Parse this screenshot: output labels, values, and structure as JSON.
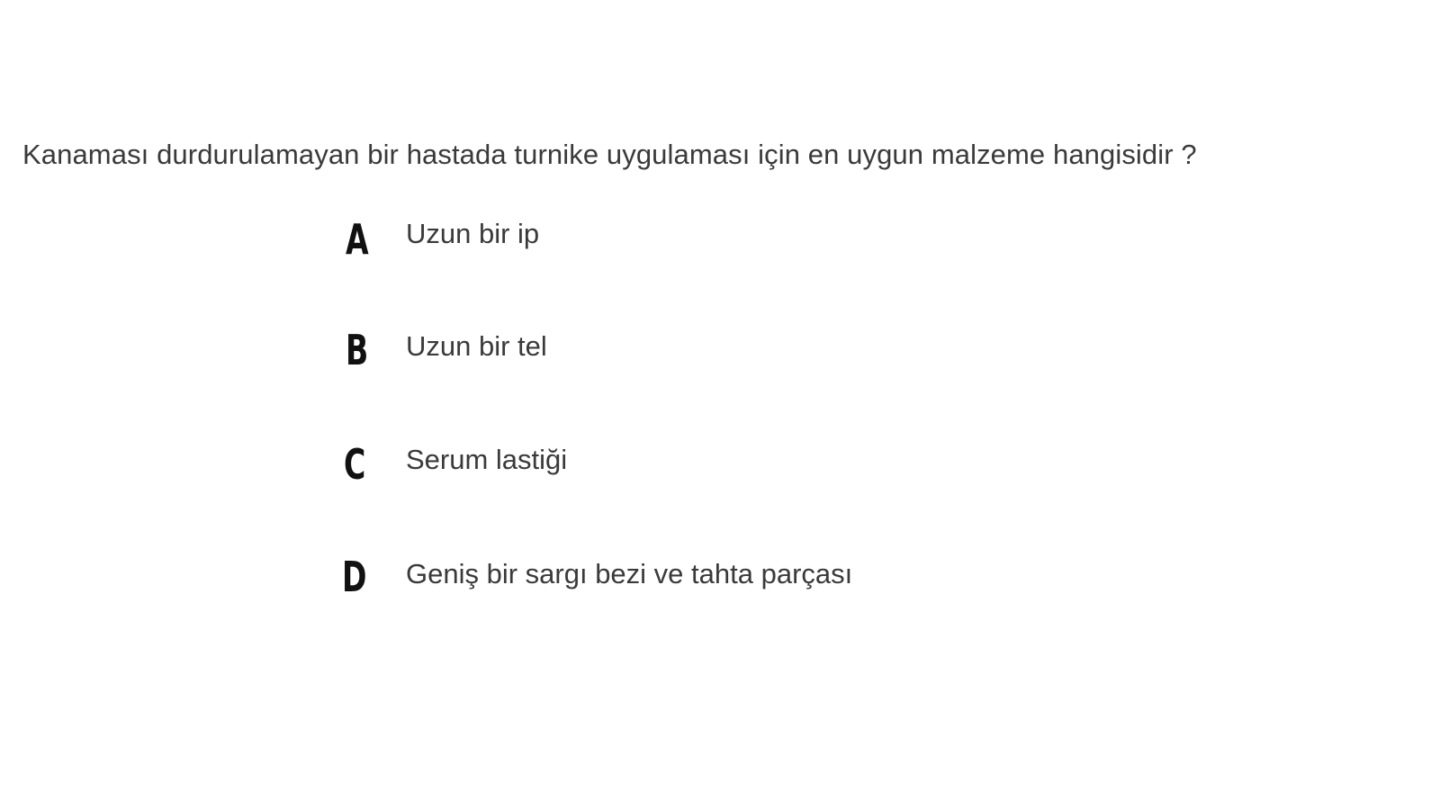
{
  "question": {
    "text": "Kanaması durdurulamayan bir hastada turnike uygulaması için en uygun malzeme hangisidir ?"
  },
  "options": [
    {
      "letter": "A",
      "text": "Uzun bir ip"
    },
    {
      "letter": "B",
      "text": "Uzun bir tel"
    },
    {
      "letter": "C",
      "text": "Serum lastiği"
    },
    {
      "letter": "D",
      "text": "Geniş bir sargı bezi ve tahta parçası"
    }
  ]
}
